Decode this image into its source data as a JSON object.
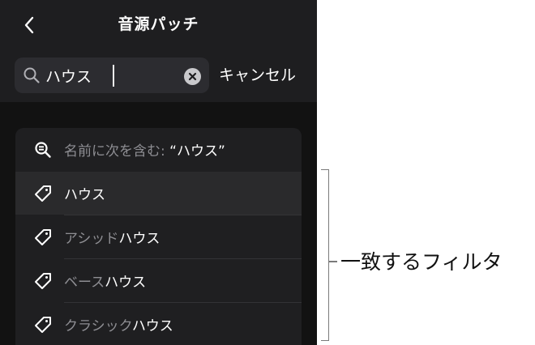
{
  "header": {
    "title": "音源パッチ",
    "back_icon": "chevron-left-icon"
  },
  "search": {
    "value": "ハウス",
    "placeholder": "",
    "search_icon": "magnifier-icon",
    "clear_icon": "clear-circle-icon",
    "cancel_label": "キャンセル"
  },
  "results": {
    "search_row": {
      "icon": "zoom-search-icon",
      "prefix": "名前に次を含む: ",
      "query": "“ハウス”"
    },
    "items": [
      {
        "icon": "tag-icon",
        "prefix": "",
        "match": "ハウス"
      },
      {
        "icon": "tag-icon",
        "prefix": "アシッド",
        "match": "ハウス"
      },
      {
        "icon": "tag-icon",
        "prefix": "ベース",
        "match": "ハウス"
      },
      {
        "icon": "tag-icon",
        "prefix": "クラシック",
        "match": "ハウス"
      }
    ]
  },
  "annotation": {
    "label": "一致するフィルタ"
  },
  "colors": {
    "background": "#121212",
    "header": "#1e1e20",
    "list": "#1f1f21",
    "selected_row": "#2a2a2c",
    "dim_text": "#8e8e93",
    "bright_text": "#ffffff"
  }
}
